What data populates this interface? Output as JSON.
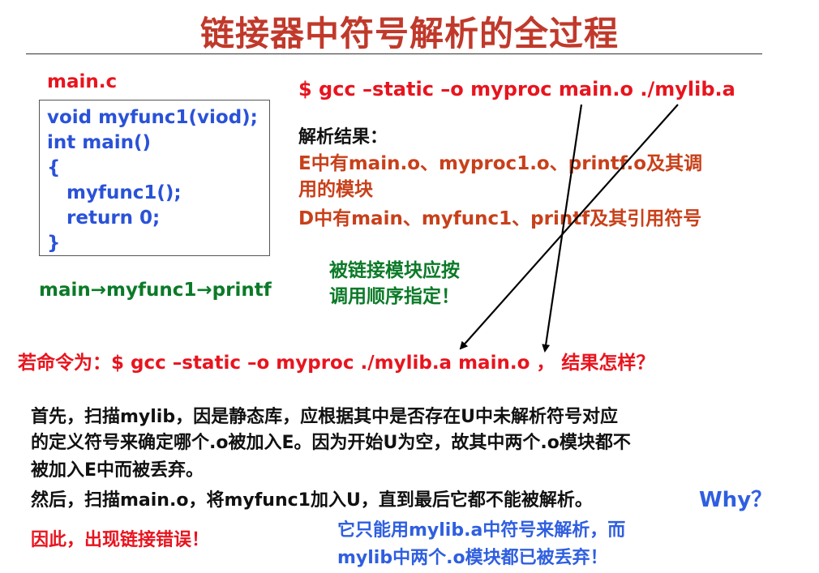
{
  "title": "链接器中符号解析的全过程",
  "code_file": {
    "label": "main.c",
    "lines": [
      "void myfunc1(viod);",
      "int main()",
      "{",
      "   myfunc1();",
      "   return 0;",
      "}"
    ]
  },
  "call_chain": "main→myfunc1→printf",
  "command1": "$ gcc –static –o myproc main.o ./mylib.a",
  "result": {
    "label": "解析结果：",
    "lines": [
      "E中有main.o、myproc1.o、printf.o及其调",
      "用的模块",
      "D中有main、myfunc1、printf及其引用符号"
    ]
  },
  "hint_lines": [
    "被链接模块应按",
    "调用顺序指定！"
  ],
  "command2": "若命令为：$ gcc –static –o myproc ./mylib.a main.o ， 结果怎样？",
  "explanation_lines": [
    "首先，扫描mylib，因是静态库，应根据其中是否存在U中未解析符号对应",
    "的定义符号来确定哪个.o被加入E。因为开始U为空，故其中两个.o模块都不",
    "被加入E中而被丢弃。",
    "然后，扫描main.o，将myfunc1加入U，直到最后它都不能被解析。"
  ],
  "why_label": "Why？",
  "conclusion": "因此，出现链接错误！",
  "reason_lines": [
    "它只能用mylib.a中符号来解析，而",
    "mylib中两个.o模块都已被丢弃！"
  ]
}
